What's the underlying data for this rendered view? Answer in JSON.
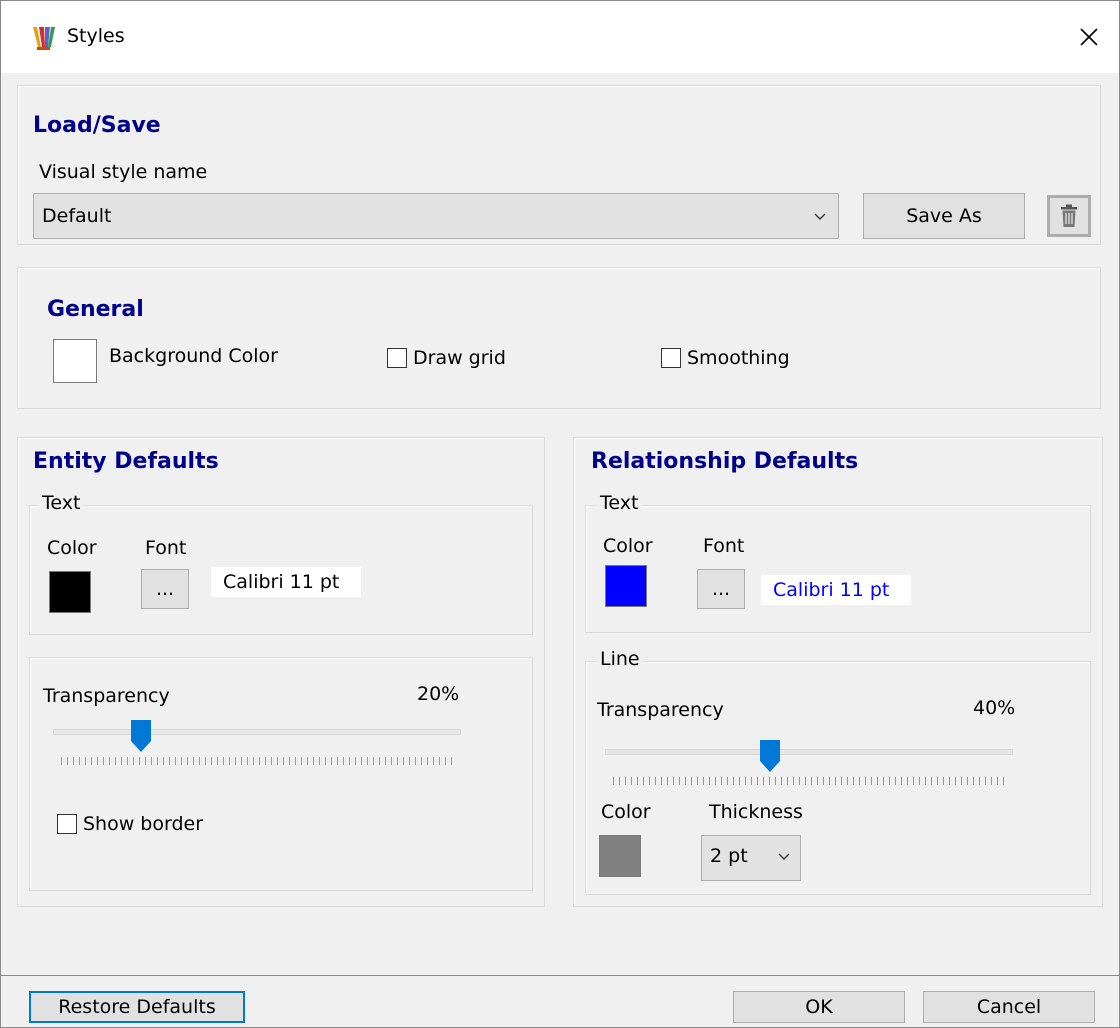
{
  "window": {
    "title": "Styles"
  },
  "load_save": {
    "title": "Load/Save",
    "style_name_label": "Visual style name",
    "style_name_value": "Default",
    "save_as_label": "Save As"
  },
  "general": {
    "title": "General",
    "background_color_label": "Background Color",
    "background_color": "#ffffff",
    "draw_grid_label": "Draw grid",
    "draw_grid_checked": false,
    "smoothing_label": "Smoothing",
    "smoothing_checked": false
  },
  "entity": {
    "title": "Entity Defaults",
    "text_legend": "Text",
    "color_label": "Color",
    "font_label": "Font",
    "text_color": "#000000",
    "font_button_label": "...",
    "font_preview": "Calibri 11 pt",
    "font_preview_color": "#000000",
    "transparency_label": "Transparency",
    "transparency_value_text": "20%",
    "transparency_value": 0.2,
    "show_border_label": "Show border",
    "show_border_checked": false
  },
  "relationship": {
    "title": "Relationship Defaults",
    "text_legend": "Text",
    "color_label": "Color",
    "font_label": "Font",
    "text_color": "#0000ff",
    "font_button_label": "...",
    "font_preview": "Calibri 11 pt",
    "font_preview_color": "#0000ff",
    "line_legend": "Line",
    "transparency_label": "Transparency",
    "transparency_value_text": "40%",
    "transparency_value": 0.4,
    "line_color_label": "Color",
    "line_color": "#808080",
    "thickness_label": "Thickness",
    "thickness_value": "2 pt"
  },
  "footer": {
    "restore_defaults_label": "Restore Defaults",
    "ok_label": "OK",
    "cancel_label": "Cancel"
  },
  "icons": {
    "app": "palette-icon",
    "close": "close-icon",
    "delete": "trash-icon",
    "dropdown": "chevron-down-icon"
  }
}
